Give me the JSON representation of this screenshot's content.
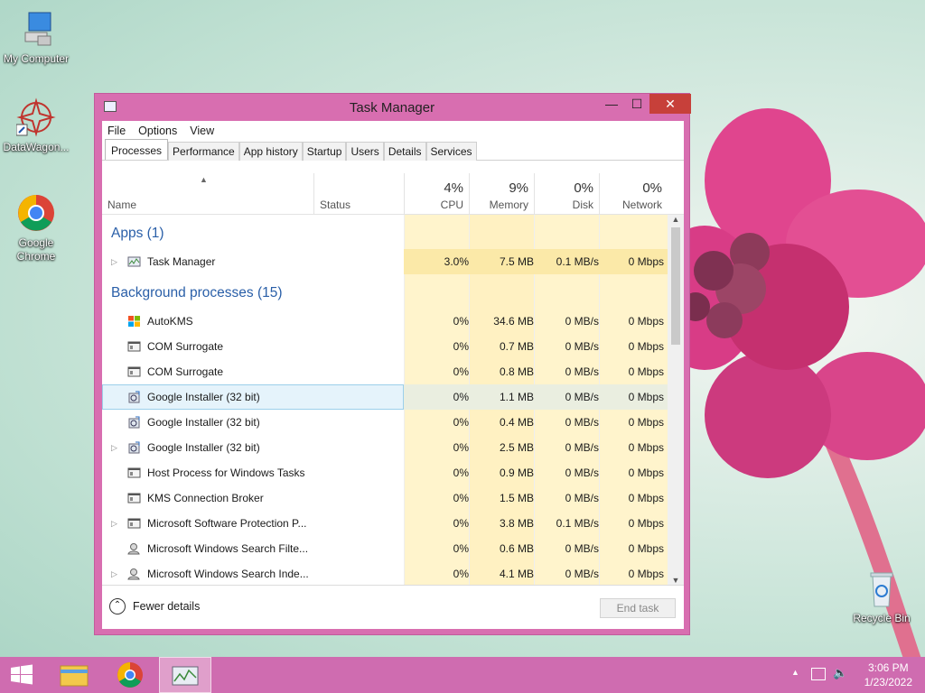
{
  "desktop": {
    "icons": [
      {
        "label": "My Computer",
        "icon": "computer-icon"
      },
      {
        "label": "DataWagon...",
        "icon": "datawagon-icon"
      },
      {
        "label": "Google Chrome",
        "icon": "chrome-icon"
      },
      {
        "label": "Recycle Bin",
        "icon": "recycle-bin-icon"
      }
    ]
  },
  "window": {
    "title": "Task Manager",
    "controls": {
      "minimize": "—",
      "maximize": "☐",
      "close": "✕"
    }
  },
  "menu": {
    "file": "File",
    "options": "Options",
    "view": "View"
  },
  "tabs": [
    "Processes",
    "Performance",
    "App history",
    "Startup",
    "Users",
    "Details",
    "Services"
  ],
  "columns": {
    "name": "Name",
    "status": "Status",
    "cpu": {
      "pct": "4%",
      "label": "CPU"
    },
    "memory": {
      "pct": "9%",
      "label": "Memory"
    },
    "disk": {
      "pct": "0%",
      "label": "Disk"
    },
    "network": {
      "pct": "0%",
      "label": "Network"
    }
  },
  "groups": {
    "apps": "Apps (1)",
    "background": "Background processes (15)"
  },
  "apps": [
    {
      "name": "Task Manager",
      "cpu": "3.0%",
      "mem": "7.5 MB",
      "disk": "0.1 MB/s",
      "net": "0 Mbps",
      "expandable": true,
      "icon": "task-manager-icon"
    }
  ],
  "processes": [
    {
      "name": "AutoKMS",
      "cpu": "0%",
      "mem": "34.6 MB",
      "disk": "0 MB/s",
      "net": "0 Mbps",
      "expandable": false,
      "icon": "windows-logo-icon"
    },
    {
      "name": "COM Surrogate",
      "cpu": "0%",
      "mem": "0.7 MB",
      "disk": "0 MB/s",
      "net": "0 Mbps",
      "expandable": false,
      "icon": "window-app-icon"
    },
    {
      "name": "COM Surrogate",
      "cpu": "0%",
      "mem": "0.8 MB",
      "disk": "0 MB/s",
      "net": "0 Mbps",
      "expandable": false,
      "icon": "window-app-icon"
    },
    {
      "name": "Google Installer (32 bit)",
      "cpu": "0%",
      "mem": "1.1 MB",
      "disk": "0 MB/s",
      "net": "0 Mbps",
      "expandable": false,
      "icon": "installer-icon",
      "selected": true
    },
    {
      "name": "Google Installer (32 bit)",
      "cpu": "0%",
      "mem": "0.4 MB",
      "disk": "0 MB/s",
      "net": "0 Mbps",
      "expandable": false,
      "icon": "installer-icon"
    },
    {
      "name": "Google Installer (32 bit)",
      "cpu": "0%",
      "mem": "2.5 MB",
      "disk": "0 MB/s",
      "net": "0 Mbps",
      "expandable": true,
      "icon": "installer-icon"
    },
    {
      "name": "Host Process for Windows Tasks",
      "cpu": "0%",
      "mem": "0.9 MB",
      "disk": "0 MB/s",
      "net": "0 Mbps",
      "expandable": false,
      "icon": "window-app-icon"
    },
    {
      "name": "KMS Connection Broker",
      "cpu": "0%",
      "mem": "1.5 MB",
      "disk": "0 MB/s",
      "net": "0 Mbps",
      "expandable": false,
      "icon": "window-app-icon"
    },
    {
      "name": "Microsoft Software Protection P...",
      "cpu": "0%",
      "mem": "3.8 MB",
      "disk": "0.1 MB/s",
      "net": "0 Mbps",
      "expandable": true,
      "icon": "window-app-icon"
    },
    {
      "name": "Microsoft Windows Search Filte...",
      "cpu": "0%",
      "mem": "0.6 MB",
      "disk": "0 MB/s",
      "net": "0 Mbps",
      "expandable": false,
      "icon": "search-user-icon"
    },
    {
      "name": "Microsoft Windows Search Inde...",
      "cpu": "0%",
      "mem": "4.1 MB",
      "disk": "0 MB/s",
      "net": "0 Mbps",
      "expandable": true,
      "icon": "search-user-icon"
    }
  ],
  "footer": {
    "fewer_details": "Fewer details",
    "end_task": "End task"
  },
  "clock": {
    "time": "3:06 PM",
    "date": "1/23/2022"
  },
  "colors": {
    "accent": "#d86eb0",
    "taskbar": "#cf6cb0",
    "close": "#c7403a",
    "group_text": "#2a5fa8",
    "heat_light": "#fff4cc",
    "heat_mid": "#fbe9a8"
  }
}
